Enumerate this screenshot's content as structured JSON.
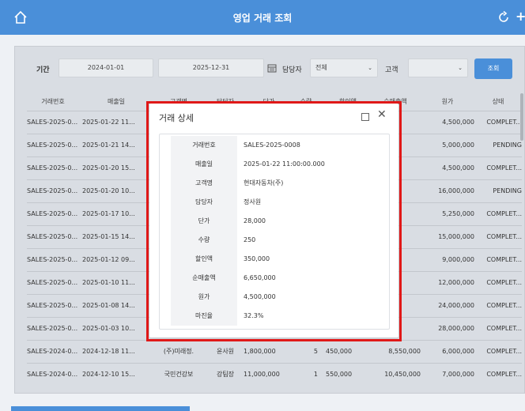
{
  "header": {
    "title": "영업 거래 조회",
    "home_icon": "home-icon",
    "refresh_icon": "refresh-icon",
    "plus": "+"
  },
  "filter": {
    "period_label": "기간",
    "start_date": "2024-01-01",
    "tilde": "~",
    "end_date": "2025-12-31",
    "manager_label": "담당자",
    "manager_value": "전체",
    "customer_label": "고객",
    "customer_value": "",
    "search_label": "조회"
  },
  "table": {
    "headers": [
      "거래번호",
      "매출일",
      "고객명",
      "담당자",
      "단가",
      "수량",
      "할인액",
      "순매출액",
      "원가",
      "상태"
    ],
    "rows": [
      [
        "SALES-2025-0...",
        "2025-01-22 11...",
        "",
        "",
        "",
        "",
        "",
        "",
        "4,500,000",
        "COMPLET..."
      ],
      [
        "SALES-2025-0...",
        "2025-01-21 14...",
        "",
        "",
        "",
        "",
        "",
        "",
        "5,000,000",
        "PENDING"
      ],
      [
        "SALES-2025-0...",
        "2025-01-20 15...",
        "",
        "",
        "",
        "",
        "",
        "",
        "4,500,000",
        "COMPLET..."
      ],
      [
        "SALES-2025-0...",
        "2025-01-20 10...",
        "",
        "",
        "",
        "",
        "",
        "",
        "16,000,000",
        "PENDING"
      ],
      [
        "SALES-2025-0...",
        "2025-01-17 10...",
        "",
        "",
        "",
        "",
        "",
        "",
        "5,250,000",
        "COMPLET..."
      ],
      [
        "SALES-2025-0...",
        "2025-01-15 14...",
        "",
        "",
        "",
        "",
        "",
        "",
        "15,000,000",
        "COMPLET..."
      ],
      [
        "SALES-2025-0...",
        "2025-01-12 09...",
        "",
        "",
        "",
        "",
        "",
        "",
        "9,000,000",
        "COMPLET..."
      ],
      [
        "SALES-2025-0...",
        "2025-01-10 11...",
        "",
        "",
        "",
        "",
        "",
        "",
        "12,000,000",
        "COMPLET..."
      ],
      [
        "SALES-2025-0...",
        "2025-01-08 14...",
        "",
        "",
        "",
        "",
        "",
        "",
        "24,000,000",
        "COMPLET..."
      ],
      [
        "SALES-2025-0...",
        "2025-01-03 10...",
        "",
        "",
        "",
        "",
        "",
        "",
        "28,000,000",
        "COMPLET..."
      ],
      [
        "SALES-2024-0...",
        "2024-12-18 11...",
        "(주)미래정.",
        "윤사원",
        "1,800,000",
        "5",
        "450,000",
        "8,550,000",
        "6,000,000",
        "COMPLET..."
      ],
      [
        "SALES-2024-0...",
        "2024-12-10 15...",
        "국민건강보",
        "강팀장",
        "11,000,000",
        "1",
        "550,000",
        "10,450,000",
        "7,000,000",
        "COMPLET..."
      ]
    ]
  },
  "modal": {
    "title": "거래 상세",
    "fields": [
      {
        "label": "거래번호",
        "value": "SALES-2025-0008"
      },
      {
        "label": "매출일",
        "value": "2025-01-22 11:00:00.000"
      },
      {
        "label": "고객명",
        "value": "현대자동차(주)"
      },
      {
        "label": "담당자",
        "value": "정사원"
      },
      {
        "label": "단가",
        "value": "28,000"
      },
      {
        "label": "수량",
        "value": "250"
      },
      {
        "label": "할인액",
        "value": "350,000"
      },
      {
        "label": "순매출액",
        "value": "6,650,000"
      },
      {
        "label": "원가",
        "value": "4,500,000"
      },
      {
        "label": "마진율",
        "value": "32.3%"
      }
    ]
  }
}
